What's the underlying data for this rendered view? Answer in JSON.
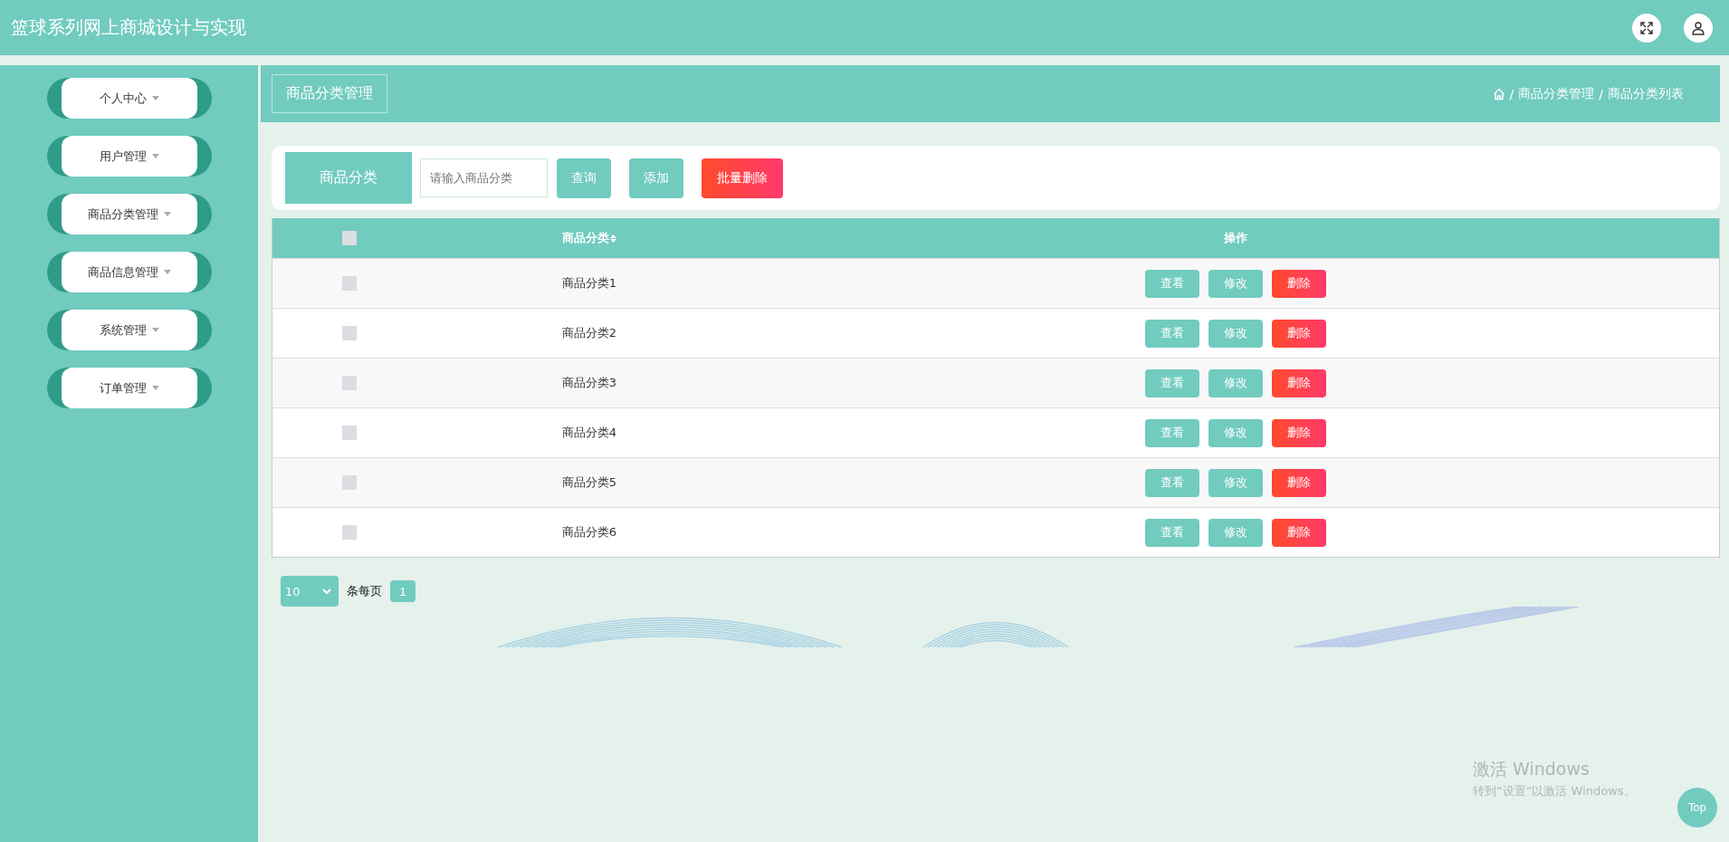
{
  "app_title": "篮球系列网上商城设计与实现",
  "sidebar": {
    "items": [
      {
        "label": "个人中心",
        "expanded": false
      },
      {
        "label": "用户管理",
        "expanded": false
      },
      {
        "label": "商品分类管理",
        "expanded": false
      },
      {
        "label": "商品信息管理",
        "expanded": false
      },
      {
        "label": "系统管理",
        "expanded": false
      },
      {
        "label": "订单管理",
        "expanded": false
      }
    ]
  },
  "page_header": {
    "title": "商品分类管理",
    "breadcrumb": [
      {
        "separator": "/",
        "label": "商品分类管理"
      },
      {
        "separator": "/",
        "label": "商品分类列表"
      }
    ]
  },
  "search": {
    "label": "商品分类",
    "placeholder": "请输入商品分类",
    "buttons": [
      {
        "label": "查询",
        "kind": "primary"
      },
      {
        "label": "添加",
        "kind": "primary"
      },
      {
        "label": "批量删除",
        "kind": "danger"
      }
    ]
  },
  "table": {
    "select_all": {
      "checked": false
    },
    "columns": [
      "商品分类",
      "操作"
    ],
    "rows": [
      {
        "checked": false,
        "category": "商品分类1",
        "actions": [
          {
            "label": "查看",
            "kind": "primary"
          },
          {
            "label": "修改",
            "kind": "primary"
          },
          {
            "label": "删除",
            "kind": "danger"
          }
        ]
      },
      {
        "checked": false,
        "category": "商品分类2",
        "actions": [
          {
            "label": "查看",
            "kind": "primary"
          },
          {
            "label": "修改",
            "kind": "primary"
          },
          {
            "label": "删除",
            "kind": "danger"
          }
        ]
      },
      {
        "checked": false,
        "category": "商品分类3",
        "actions": [
          {
            "label": "查看",
            "kind": "primary"
          },
          {
            "label": "修改",
            "kind": "primary"
          },
          {
            "label": "删除",
            "kind": "danger"
          }
        ]
      },
      {
        "checked": false,
        "category": "商品分类4",
        "actions": [
          {
            "label": "查看",
            "kind": "primary"
          },
          {
            "label": "修改",
            "kind": "primary"
          },
          {
            "label": "删除",
            "kind": "danger"
          }
        ]
      },
      {
        "checked": false,
        "category": "商品分类5",
        "actions": [
          {
            "label": "查看",
            "kind": "primary"
          },
          {
            "label": "修改",
            "kind": "primary"
          },
          {
            "label": "删除",
            "kind": "danger"
          }
        ]
      },
      {
        "checked": false,
        "category": "商品分类6",
        "actions": [
          {
            "label": "查看",
            "kind": "primary"
          },
          {
            "label": "修改",
            "kind": "primary"
          },
          {
            "label": "删除",
            "kind": "danger"
          }
        ]
      }
    ]
  },
  "pagination": {
    "page_size": "10",
    "page_size_label": "条每页",
    "pages": [
      {
        "label": "1",
        "selected": true
      }
    ]
  },
  "windows_notice": {
    "title": "激活 Windows",
    "subtitle": "转到“设置”以激活 Windows。"
  },
  "top_button": "Top"
}
